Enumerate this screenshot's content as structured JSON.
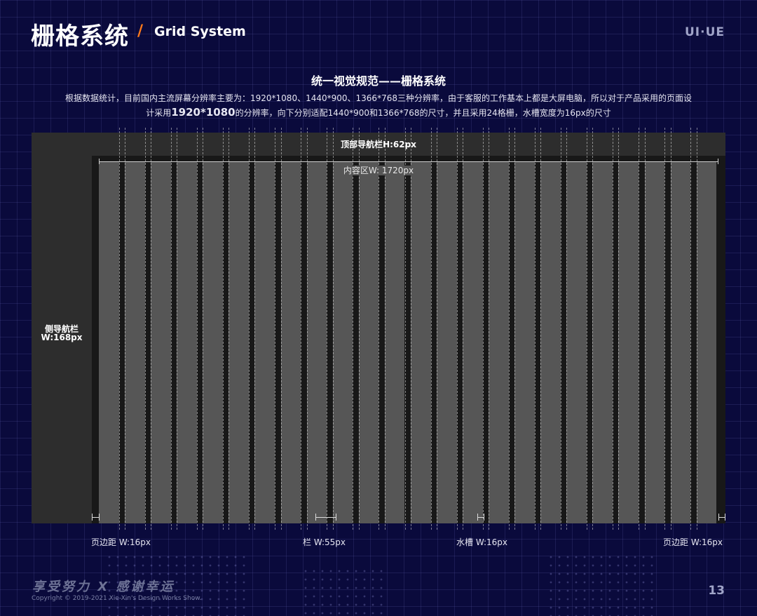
{
  "header": {
    "title_cn": "栅格系统",
    "slash": "/",
    "title_en": "Grid System",
    "brand": "UI·UE"
  },
  "heading": "统一视觉规范——栅格系统",
  "description": {
    "line1": "根据数据统计，目前国内主流屏幕分辨率主要为：1920*1080、1440*900、1366*768三种分辨率，由于客服的工作基本上都是大屏电脑，所以对于产品采用的页面设",
    "line2_prefix": "计采用",
    "line2_bold": "1920*1080",
    "line2_suffix": "的分辨率，向下分别适配1440*900和1366*768的尺寸，并且采用24格栅，水槽宽度为16px的尺寸"
  },
  "diagram": {
    "topbar_label": "顶部导航栏H:62px",
    "sidebar_label_line1": "侧导航栏",
    "sidebar_label_line2": "W:168px",
    "content_label": "内容区W: 1720px",
    "column_count": 24,
    "bottom_labels": {
      "margin_left": "页边距 W:16px",
      "column": "栏 W:55px",
      "gutter": "水槽 W:16px",
      "margin_right": "页边距 W:16px"
    }
  },
  "footer": {
    "slogan": "享受努力 X 感谢幸运",
    "copyright": "Copyright © 2019-2021 Xie-Xin's Design Works Show.",
    "page_number": "13"
  },
  "colors": {
    "background": "#0a0a3c",
    "accent": "#ff7a1a",
    "panel": "#2d2d2d",
    "column": "#565656"
  }
}
